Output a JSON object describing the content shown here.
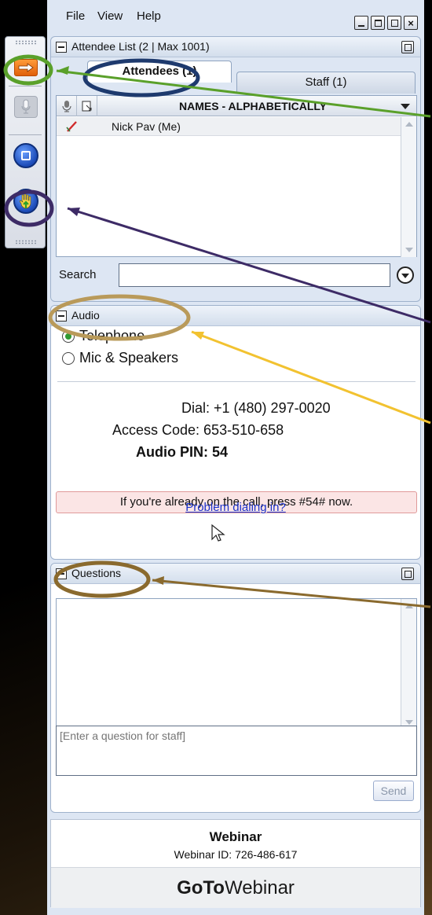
{
  "menubar": {
    "file": "File",
    "view": "View",
    "help": "Help"
  },
  "attendee_panel": {
    "title": "Attendee List  (2 | Max 1001)",
    "tabs": [
      {
        "label": "Attendees (1)",
        "active": true
      },
      {
        "label": "Staff (1)",
        "active": false
      }
    ],
    "column_header": "NAMES - ALPHABETICALLY",
    "rows": [
      {
        "name": "Nick Pav (Me)",
        "mic": "muted"
      }
    ],
    "search_label": "Search",
    "search_value": ""
  },
  "audio_panel": {
    "title": "Audio",
    "options": [
      {
        "label": "Telephone",
        "selected": true
      },
      {
        "label": "Mic & Speakers",
        "selected": false
      }
    ],
    "dial": "Dial: +1 (480) 297-0020",
    "access_code": "Access Code: 653-510-658",
    "audio_pin": "Audio PIN: 54",
    "notice": "If you're already on the call, press #54# now.",
    "help_link": "Problem dialing in?"
  },
  "questions_panel": {
    "title": "Questions",
    "input_placeholder": "[Enter a question for staff]",
    "send_label": "Send"
  },
  "footer": {
    "title": "Webinar",
    "webinar_id": "Webinar ID: 726-486-617",
    "logo_bold": "GoTo",
    "logo_rest": "Webinar"
  },
  "colors": {
    "orange_button": "#f07a1a",
    "blue_button": "#1c4bb8",
    "annotation_green": "#5aa02a",
    "annotation_navy": "#1e3a6e",
    "annotation_purple": "#3d2b66",
    "annotation_tan": "#b99a5a",
    "annotation_brown": "#8a6a2e",
    "annotation_yellow": "#f2c230"
  }
}
